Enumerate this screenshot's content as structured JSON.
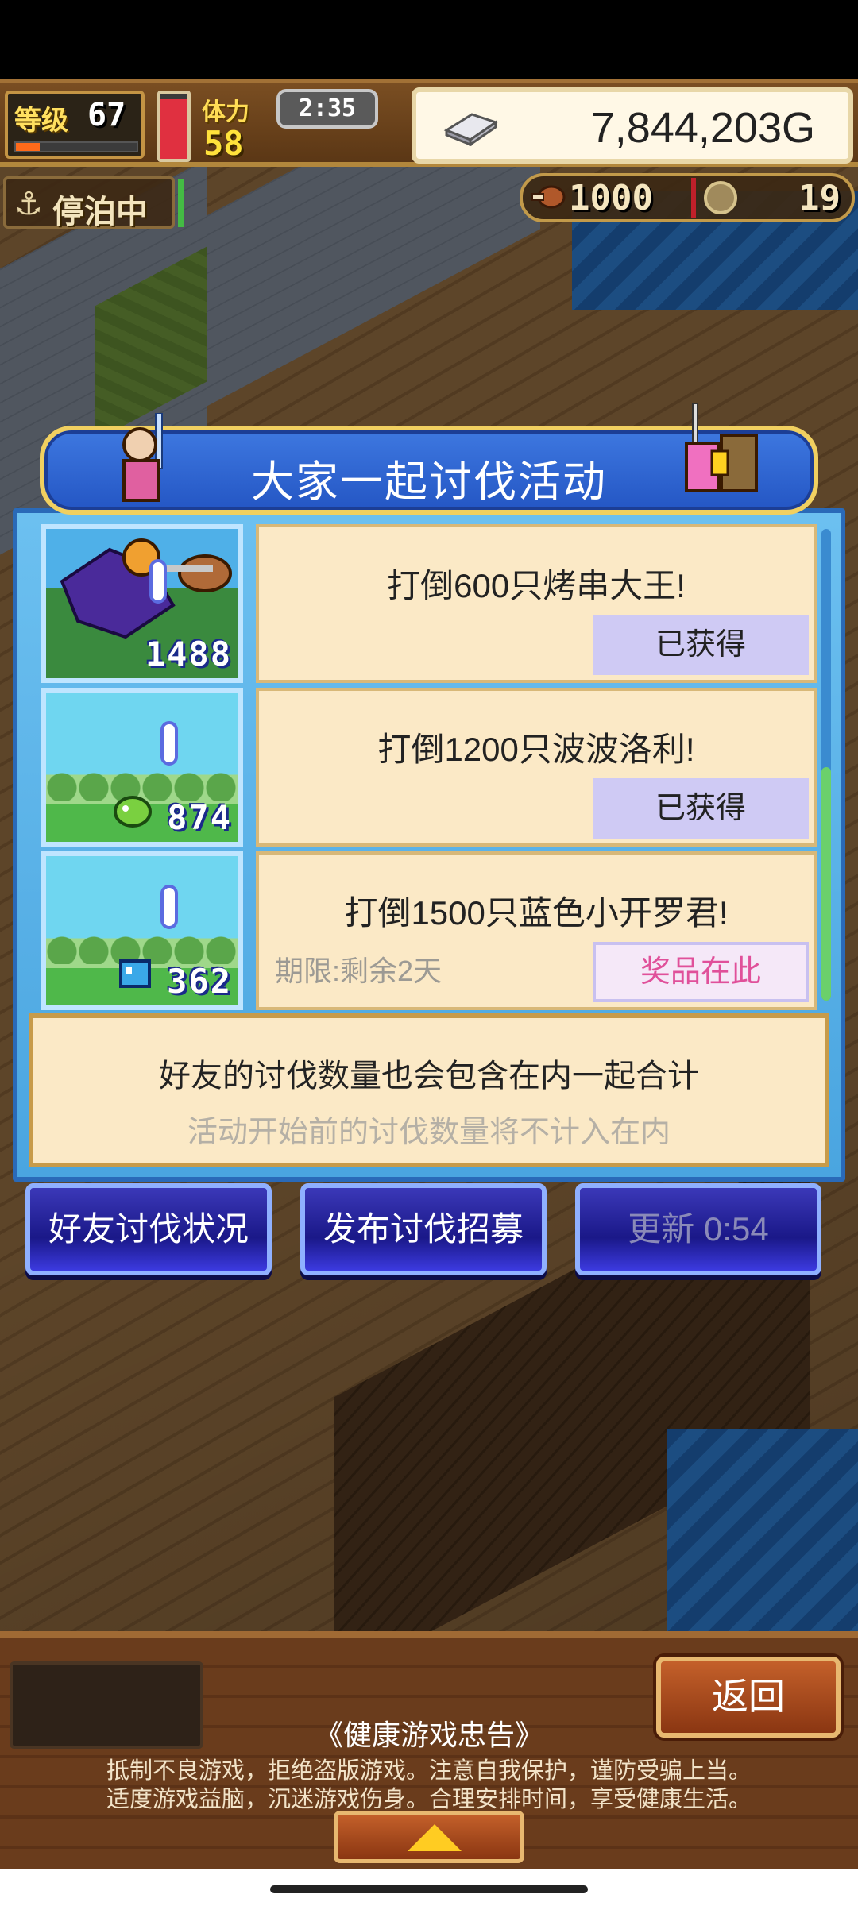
{
  "hud": {
    "level_label": "等级",
    "level_value": "67",
    "exp_progress": 0.2,
    "stamina_progress": 0.92,
    "stamina_label": "体力",
    "stamina_value": "58",
    "timer": "2:35",
    "gold_value": "7,844,203G"
  },
  "status": {
    "moored_label": "停泊中",
    "meat_value": "1000",
    "coin_value": "19"
  },
  "event": {
    "title": "大家一起讨伐活动",
    "tasks": [
      {
        "count": "1488",
        "text": "打倒600只烤串大王!",
        "status": "已获得"
      },
      {
        "count": "874",
        "text": "打倒1200只波波洛利!",
        "status": "已获得"
      },
      {
        "count": "362",
        "text": "打倒1500只蓝色小开罗君!",
        "status": "奖品在此",
        "deadline": "期限:剩余2天"
      }
    ],
    "note_main": "好友的讨伐数量也会包含在内一起合计",
    "note_sub": "活动开始前的讨伐数量将不计入在内"
  },
  "actions": {
    "friends_status": "好友讨伐状况",
    "post_recruit": "发布讨伐招募",
    "refresh": "更新 0:54"
  },
  "bottom": {
    "back": "返回",
    "health_title": "《健康游戏忠告》",
    "health_line1": "抵制不良游戏，拒绝盗版游戏。注意自我保护，谨防受骗上当。",
    "health_line2": "适度游戏益脑，沉迷游戏伤身。合理安排时间，享受健康生活。"
  },
  "colors": {
    "panel_blue": "#4aa5e0",
    "header_blue": "#2456c4",
    "card_cream": "#fbe9c6",
    "reward_pink": "#e0509a",
    "claimed_lavender": "#cfcaf4"
  }
}
